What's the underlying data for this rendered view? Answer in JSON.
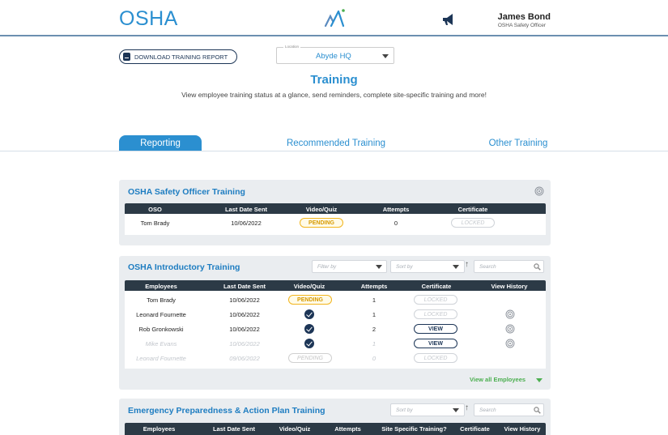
{
  "header": {
    "brand": "OSHA",
    "user_name": "James Bond",
    "user_role": "OSHA Safety Officer",
    "icons": [
      "abyde-logo-icon",
      "megaphone-icon"
    ]
  },
  "toolbar": {
    "download_label": "DOWNLOAD TRAINING REPORT",
    "location_label": "Location",
    "location_value": "Abyde HQ"
  },
  "page": {
    "title": "Training",
    "subtitle": "View employee training status at a glance, send reminders, complete site-specific training and more!"
  },
  "tabs": [
    {
      "label": "Reporting",
      "active": true
    },
    {
      "label": "Recommended Training",
      "active": false
    },
    {
      "label": "Other Training",
      "active": false
    }
  ],
  "oso_card": {
    "title": "OSHA Safety Officer Training",
    "columns": [
      "OSO",
      "Last Date Sent",
      "Video/Quiz",
      "Attempts",
      "Certificate"
    ],
    "rows": [
      {
        "name": "Tom Brady",
        "date": "10/06/2022",
        "status": "PENDING",
        "attempts": "0",
        "certificate": "LOCKED"
      }
    ]
  },
  "intro_card": {
    "title": "OSHA Introductory Training",
    "filter_placeholder": "Filter by",
    "sort_placeholder": "Sort by",
    "search_placeholder": "Search",
    "columns": [
      "Employees",
      "Last Date Sent",
      "Video/Quiz",
      "Attempts",
      "Certificate",
      "View History"
    ],
    "rows": [
      {
        "name": "Tom Brady",
        "date": "10/06/2022",
        "status": "PENDING",
        "attempts": "1",
        "certificate": "LOCKED",
        "history": false,
        "dim": false
      },
      {
        "name": "Leonard Fournette",
        "date": "10/06/2022",
        "status": "check",
        "attempts": "1",
        "certificate": "LOCKED",
        "history": true,
        "dim": false
      },
      {
        "name": "Rob Gronkowski",
        "date": "10/06/2022",
        "status": "check",
        "attempts": "2",
        "certificate": "VIEW",
        "history": true,
        "dim": false
      },
      {
        "name": "Mike Evans",
        "date": "10/06/2022",
        "status": "check",
        "attempts": "1",
        "certificate": "VIEW",
        "history": true,
        "dim": true
      },
      {
        "name": "Leonard Fournette",
        "date": "09/06/2022",
        "status": "PENDING",
        "attempts": "0",
        "certificate": "LOCKED",
        "history": false,
        "dim": true
      }
    ],
    "view_all": "View all Employees"
  },
  "emergency_card": {
    "title": "Emergency Preparedness & Action Plan Training",
    "sort_placeholder": "Sort by",
    "search_placeholder": "Search",
    "columns": [
      "Employees",
      "Last Date Sent",
      "Video/Quiz",
      "Attempts",
      "Site Specific Training?",
      "Certificate",
      "View History"
    ]
  },
  "colors": {
    "brand_blue": "#2b8fd0",
    "navy": "#1c3556",
    "table_header": "#2c3a46",
    "pending": "#f2b51d",
    "view_all_green": "#4caf50"
  }
}
